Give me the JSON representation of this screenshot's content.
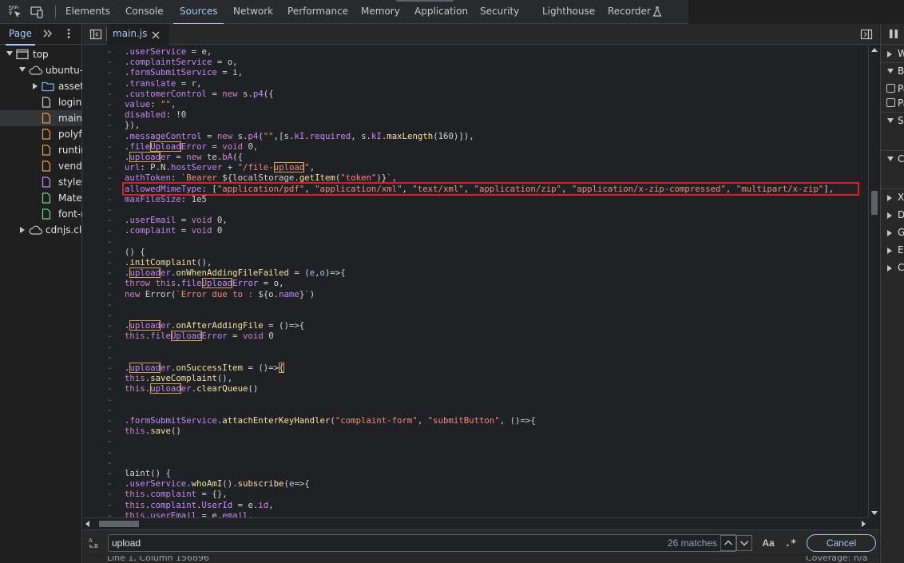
{
  "colors": {
    "accent": "#a8c7fa",
    "highlight_border": "#e31b23",
    "match_outline": "#d7a34d"
  },
  "top_tabs": [
    {
      "label": "Elements"
    },
    {
      "label": "Console"
    },
    {
      "label": "Sources",
      "active": true
    },
    {
      "label": "Network"
    },
    {
      "label": "Performance"
    },
    {
      "label": "Memory"
    },
    {
      "label": "Application"
    },
    {
      "label": "Security"
    },
    {
      "label": "Lighthouse"
    },
    {
      "label": "Recorder"
    }
  ],
  "navigator": {
    "tab_label": "Page",
    "tree": [
      {
        "label": "top",
        "icon": "frame-icon",
        "expanded": true
      },
      {
        "label": "ubuntu-s",
        "icon": "cloud-icon",
        "expanded": true
      },
      {
        "label": "assets/",
        "icon": "folder-icon",
        "expanded": false
      },
      {
        "label": "login",
        "icon": "document-icon"
      },
      {
        "label": "main.js",
        "icon": "script-file-icon",
        "selected": true
      },
      {
        "label": "polyfills",
        "icon": "script-file-icon"
      },
      {
        "label": "runtime",
        "icon": "script-file-icon"
      },
      {
        "label": "vendor",
        "icon": "script-file-icon"
      },
      {
        "label": "styles.c",
        "icon": "stylesheet-file-icon"
      },
      {
        "label": "Materia",
        "icon": "font-file-icon"
      },
      {
        "label": "font-mf",
        "icon": "font-file-icon"
      },
      {
        "label": "cdnjs.clo",
        "icon": "cloud-icon",
        "expanded": false
      }
    ]
  },
  "editor": {
    "file_tab": "main.js",
    "gutter_marker": "-"
  },
  "search": {
    "query": "upload",
    "match_count": "26 matches",
    "match_case_label": "Aa",
    "regex_label": ".*",
    "cancel_label": "Cancel"
  },
  "status": {
    "position": "Line 1, Column 156896",
    "right": "Coverage: n/a"
  },
  "debugger": {
    "sections": [
      {
        "label": "Watch",
        "type": "section",
        "expanded": false
      },
      {
        "label": "Breakpoints",
        "type": "section",
        "expanded": true
      },
      {
        "label": "Pause on uncaught exceptions",
        "type": "checkbox"
      },
      {
        "label": "Pause on caught exceptions",
        "type": "checkbox"
      },
      {
        "label": "Scope",
        "type": "section",
        "expanded": true
      },
      {
        "label": "Call Stack",
        "type": "section",
        "expanded": true
      },
      {
        "label": "XHR/fetch Breakpoints",
        "type": "section",
        "expanded": false
      },
      {
        "label": "DOM Breakpoints",
        "type": "section",
        "expanded": false
      },
      {
        "label": "Global Listeners",
        "type": "section",
        "expanded": false
      },
      {
        "label": "Event Listener Breakpoints",
        "type": "section",
        "expanded": false
      },
      {
        "label": "CSP Violation Breakpoints",
        "type": "section",
        "expanded": false
      }
    ]
  },
  "code_lines": [
    [
      {
        "t": ".",
        "c": ""
      },
      {
        "t": "userService",
        "c": "pr"
      },
      {
        "t": " = e,",
        "c": ""
      }
    ],
    [
      {
        "t": ".",
        "c": ""
      },
      {
        "t": "complaintService",
        "c": "pr"
      },
      {
        "t": " = o,",
        "c": ""
      }
    ],
    [
      {
        "t": ".",
        "c": ""
      },
      {
        "t": "formSubmitService",
        "c": "pr"
      },
      {
        "t": " = i,",
        "c": ""
      }
    ],
    [
      {
        "t": ".",
        "c": ""
      },
      {
        "t": "translate",
        "c": "pr"
      },
      {
        "t": " = r,",
        "c": ""
      }
    ],
    [
      {
        "t": ".",
        "c": ""
      },
      {
        "t": "customerControl",
        "c": "pr"
      },
      {
        "t": " = ",
        "c": ""
      },
      {
        "t": "new",
        "c": "kw"
      },
      {
        "t": " s.",
        "c": ""
      },
      {
        "t": "p4",
        "c": "pr"
      },
      {
        "t": "({",
        "c": ""
      }
    ],
    [
      {
        "t": "value",
        "c": "pr"
      },
      {
        "t": ": ",
        "c": ""
      },
      {
        "t": "\"\"",
        "c": "st"
      },
      {
        "t": ",",
        "c": ""
      }
    ],
    [
      {
        "t": "disabled",
        "c": "pr"
      },
      {
        "t": ": !0",
        "c": ""
      }
    ],
    [
      {
        "t": "}),",
        "c": ""
      }
    ],
    [
      {
        "t": ".",
        "c": ""
      },
      {
        "t": "messageControl",
        "c": "pr"
      },
      {
        "t": " = ",
        "c": ""
      },
      {
        "t": "new",
        "c": "kw"
      },
      {
        "t": " s.",
        "c": ""
      },
      {
        "t": "p4",
        "c": "pr"
      },
      {
        "t": "(",
        "c": ""
      },
      {
        "t": "\"\"",
        "c": "st"
      },
      {
        "t": ",[s.",
        "c": ""
      },
      {
        "t": "kI",
        "c": "pr"
      },
      {
        "t": ".",
        "c": ""
      },
      {
        "t": "required",
        "c": "pr"
      },
      {
        "t": ", s.",
        "c": ""
      },
      {
        "t": "kI",
        "c": "pr"
      },
      {
        "t": ".",
        "c": ""
      },
      {
        "t": "maxLength",
        "c": "fn"
      },
      {
        "t": "(160)]),",
        "c": ""
      }
    ],
    [
      {
        "t": ".",
        "c": ""
      },
      {
        "t": "file",
        "c": "pr"
      },
      {
        "t": "Upload",
        "c": "pr",
        "h": true
      },
      {
        "t": "Error",
        "c": "pr"
      },
      {
        "t": " = ",
        "c": ""
      },
      {
        "t": "void",
        "c": "kw"
      },
      {
        "t": " 0,",
        "c": ""
      }
    ],
    [
      {
        "t": ".",
        "c": ""
      },
      {
        "t": "upload",
        "c": "pr",
        "h": true
      },
      {
        "t": "er",
        "c": "pr"
      },
      {
        "t": " = ",
        "c": ""
      },
      {
        "t": "new",
        "c": "kw"
      },
      {
        "t": " te.",
        "c": ""
      },
      {
        "t": "bA",
        "c": "pr"
      },
      {
        "t": "({",
        "c": ""
      }
    ],
    [
      {
        "t": "url",
        "c": "pr"
      },
      {
        "t": ": P.N.",
        "c": ""
      },
      {
        "t": "hostServer",
        "c": "pr"
      },
      {
        "t": " + ",
        "c": ""
      },
      {
        "t": "\"/file-",
        "c": "st"
      },
      {
        "t": "upload",
        "c": "st",
        "h": true
      },
      {
        "t": "\"",
        "c": "st"
      },
      {
        "t": ",",
        "c": ""
      }
    ],
    [
      {
        "t": "authToken",
        "c": "pr"
      },
      {
        "t": ": ",
        "c": ""
      },
      {
        "t": "`Bearer ",
        "c": "st"
      },
      {
        "t": "${localStorage.",
        "c": ""
      },
      {
        "t": "getItem",
        "c": "fn"
      },
      {
        "t": "(",
        "c": ""
      },
      {
        "t": "\"token\"",
        "c": "st"
      },
      {
        "t": ")}",
        "c": ""
      },
      {
        "t": "`",
        "c": "st"
      },
      {
        "t": ",",
        "c": ""
      }
    ],
    [
      {
        "t": "allowedMimeType",
        "c": "pr"
      },
      {
        "t": ": [",
        "c": ""
      },
      {
        "t": "\"application/pdf\"",
        "c": "st"
      },
      {
        "t": ", ",
        "c": ""
      },
      {
        "t": "\"application/xml\"",
        "c": "st"
      },
      {
        "t": ", ",
        "c": ""
      },
      {
        "t": "\"text/xml\"",
        "c": "st"
      },
      {
        "t": ", ",
        "c": ""
      },
      {
        "t": "\"application/zip\"",
        "c": "st"
      },
      {
        "t": ", ",
        "c": ""
      },
      {
        "t": "\"application/x-zip-compressed\"",
        "c": "st"
      },
      {
        "t": ", ",
        "c": ""
      },
      {
        "t": "\"multipart/x-zip\"",
        "c": "st"
      },
      {
        "t": "],",
        "c": ""
      }
    ],
    [
      {
        "t": "maxFileSize",
        "c": "pr"
      },
      {
        "t": ": 1e5",
        "c": ""
      }
    ],
    [],
    [
      {
        "t": ".",
        "c": ""
      },
      {
        "t": "userEmail",
        "c": "pr"
      },
      {
        "t": " = ",
        "c": ""
      },
      {
        "t": "void",
        "c": "kw"
      },
      {
        "t": " 0,",
        "c": ""
      }
    ],
    [
      {
        "t": ".",
        "c": ""
      },
      {
        "t": "complaint",
        "c": "pr"
      },
      {
        "t": " = ",
        "c": ""
      },
      {
        "t": "void",
        "c": "kw"
      },
      {
        "t": " 0",
        "c": ""
      }
    ],
    [],
    [
      {
        "t": "() {",
        "c": ""
      }
    ],
    [
      {
        "t": ".",
        "c": ""
      },
      {
        "t": "initComplaint",
        "c": "fn"
      },
      {
        "t": "(),",
        "c": ""
      }
    ],
    [
      {
        "t": ".",
        "c": ""
      },
      {
        "t": "upload",
        "c": "pr",
        "h": true
      },
      {
        "t": "er",
        "c": "pr"
      },
      {
        "t": ".",
        "c": ""
      },
      {
        "t": "onWhenAddingFileFailed",
        "c": "fn"
      },
      {
        "t": " = (",
        "c": ""
      },
      {
        "t": "e",
        "c": "vr"
      },
      {
        "t": ",",
        "c": ""
      },
      {
        "t": "o",
        "c": "vr"
      },
      {
        "t": ")=>{",
        "c": ""
      }
    ],
    [
      {
        "t": "throw",
        "c": "kw"
      },
      {
        "t": " ",
        "c": ""
      },
      {
        "t": "this",
        "c": "kw"
      },
      {
        "t": ".",
        "c": ""
      },
      {
        "t": "file",
        "c": "pr"
      },
      {
        "t": "Upload",
        "c": "pr",
        "h": true
      },
      {
        "t": "Error",
        "c": "pr"
      },
      {
        "t": " = o,",
        "c": ""
      }
    ],
    [
      {
        "t": "new",
        "c": "kw"
      },
      {
        "t": " Error(",
        "c": ""
      },
      {
        "t": "`Error due to : ",
        "c": "st"
      },
      {
        "t": "${o.",
        "c": ""
      },
      {
        "t": "name",
        "c": "pr"
      },
      {
        "t": "}",
        "c": ""
      },
      {
        "t": "`",
        "c": "st"
      },
      {
        "t": ")",
        "c": ""
      }
    ],
    [],
    [],
    [
      {
        "t": ".",
        "c": ""
      },
      {
        "t": "upload",
        "c": "pr",
        "h": true
      },
      {
        "t": "er",
        "c": "pr"
      },
      {
        "t": ".",
        "c": ""
      },
      {
        "t": "onAfterAddingFile",
        "c": "fn"
      },
      {
        "t": " = ()=>{",
        "c": ""
      }
    ],
    [
      {
        "t": "this",
        "c": "kw"
      },
      {
        "t": ".",
        "c": ""
      },
      {
        "t": "file",
        "c": "pr"
      },
      {
        "t": "Upload",
        "c": "pr",
        "h": true
      },
      {
        "t": "Error",
        "c": "pr"
      },
      {
        "t": " = ",
        "c": ""
      },
      {
        "t": "void",
        "c": "kw"
      },
      {
        "t": " 0",
        "c": ""
      }
    ],
    [],
    [],
    [
      {
        "t": ".",
        "c": ""
      },
      {
        "t": "upload",
        "c": "pr",
        "h": true
      },
      {
        "t": "er",
        "c": "pr"
      },
      {
        "t": ".",
        "c": ""
      },
      {
        "t": "onSuccessItem",
        "c": "fn"
      },
      {
        "t": " = ()=>",
        "c": ""
      },
      {
        "t": "{",
        "c": "",
        "h": true
      }
    ],
    [
      {
        "t": "this",
        "c": "kw"
      },
      {
        "t": ".",
        "c": ""
      },
      {
        "t": "saveComplaint",
        "c": "fn"
      },
      {
        "t": "(),",
        "c": ""
      }
    ],
    [
      {
        "t": "this",
        "c": "kw"
      },
      {
        "t": ".",
        "c": ""
      },
      {
        "t": "upload",
        "c": "pr",
        "h": true
      },
      {
        "t": "er",
        "c": "pr"
      },
      {
        "t": ".",
        "c": ""
      },
      {
        "t": "clearQueue",
        "c": "fn"
      },
      {
        "t": "()",
        "c": ""
      }
    ],
    [],
    [],
    [
      {
        "t": ".",
        "c": ""
      },
      {
        "t": "formSubmitService",
        "c": "pr"
      },
      {
        "t": ".",
        "c": ""
      },
      {
        "t": "attachEnterKeyHandler",
        "c": "fn"
      },
      {
        "t": "(",
        "c": ""
      },
      {
        "t": "\"complaint-form\"",
        "c": "st"
      },
      {
        "t": ", ",
        "c": ""
      },
      {
        "t": "\"submitButton\"",
        "c": "st"
      },
      {
        "t": ", ()=>{",
        "c": ""
      }
    ],
    [
      {
        "t": "this",
        "c": "kw"
      },
      {
        "t": ".",
        "c": ""
      },
      {
        "t": "save",
        "c": "fn"
      },
      {
        "t": "()",
        "c": ""
      }
    ],
    [],
    [],
    [],
    [
      {
        "t": "laint() {",
        "c": ""
      }
    ],
    [
      {
        "t": ".",
        "c": ""
      },
      {
        "t": "userService",
        "c": "pr"
      },
      {
        "t": ".",
        "c": ""
      },
      {
        "t": "whoAmI",
        "c": "fn"
      },
      {
        "t": "().",
        "c": ""
      },
      {
        "t": "subscribe",
        "c": "fn"
      },
      {
        "t": "(",
        "c": ""
      },
      {
        "t": "e",
        "c": "vr"
      },
      {
        "t": "=>{",
        "c": ""
      }
    ],
    [
      {
        "t": "this",
        "c": "kw"
      },
      {
        "t": ".",
        "c": ""
      },
      {
        "t": "complaint",
        "c": "pr"
      },
      {
        "t": " = {},",
        "c": ""
      }
    ],
    [
      {
        "t": "this",
        "c": "kw"
      },
      {
        "t": ".",
        "c": ""
      },
      {
        "t": "complaint",
        "c": "pr"
      },
      {
        "t": ".",
        "c": ""
      },
      {
        "t": "UserId",
        "c": "pr"
      },
      {
        "t": " = e.",
        "c": ""
      },
      {
        "t": "id",
        "c": "pr"
      },
      {
        "t": ",",
        "c": ""
      }
    ],
    [
      {
        "t": "this",
        "c": "kw"
      },
      {
        "t": ".",
        "c": ""
      },
      {
        "t": "userEmail",
        "c": "pr"
      },
      {
        "t": " = e.",
        "c": ""
      },
      {
        "t": "email",
        "c": "pr"
      },
      {
        "t": ",",
        "c": ""
      }
    ]
  ]
}
